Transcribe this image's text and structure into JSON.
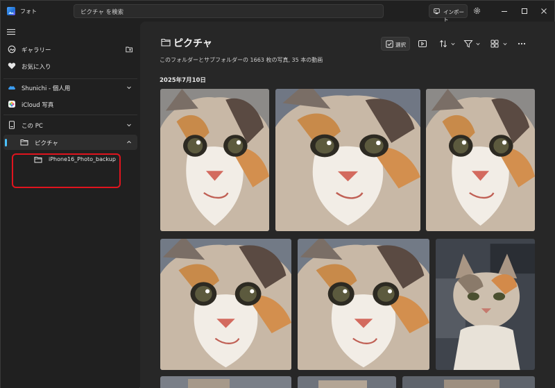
{
  "app": {
    "title": "フォト",
    "search_placeholder": "ピクチャ を検索",
    "import_label": "インポート"
  },
  "sidebar": {
    "items": [
      {
        "label": "ギャラリー",
        "icon": "gallery-icon"
      },
      {
        "label": "お気に入り",
        "icon": "heart-icon"
      },
      {
        "label": "Shunichi - 個人用",
        "icon": "onedrive-icon"
      },
      {
        "label": "iCloud 写真",
        "icon": "icloud-icon"
      },
      {
        "label": "この PC",
        "icon": "pc-icon"
      },
      {
        "label": "ピクチャ",
        "icon": "folder-icon"
      },
      {
        "label": "iPhone16_Photo_backup",
        "icon": "folder-icon"
      }
    ]
  },
  "main": {
    "title": "ピクチャ",
    "subtitle": "このフォルダーとサブフォルダーの 1663 枚の写真, 35 本の動画",
    "select_label": "選択",
    "date_group": "2025年7月10日"
  },
  "colors": {
    "accent": "#4cc2ff",
    "highlight": "#e0141e",
    "background": "#202020"
  }
}
